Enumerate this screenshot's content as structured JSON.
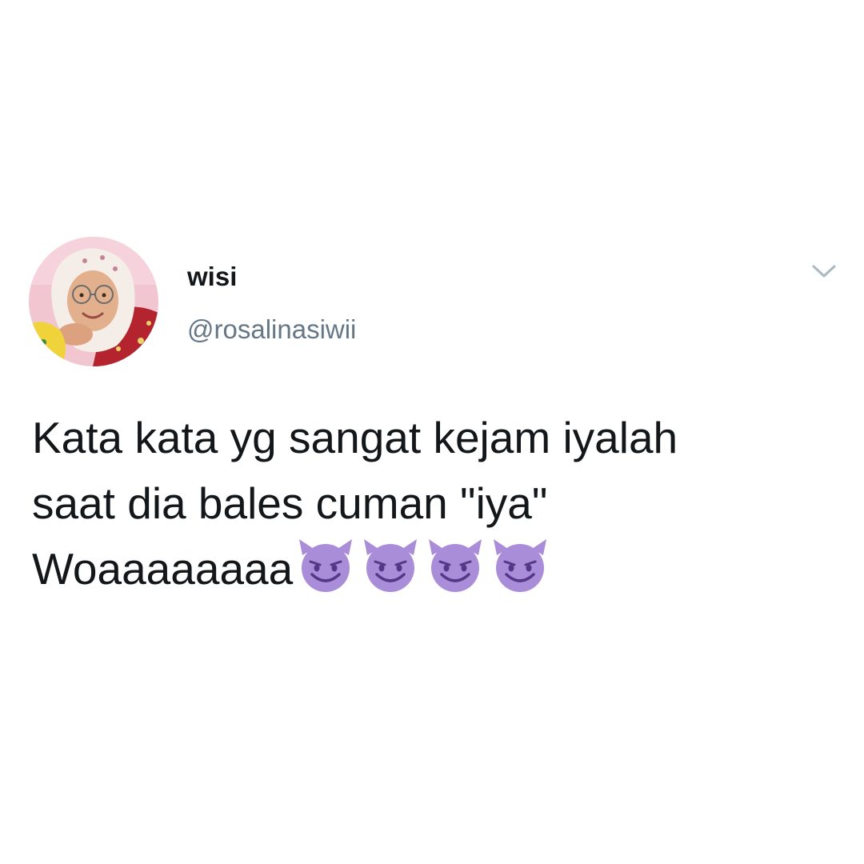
{
  "tweet": {
    "author": {
      "display_name": "wisi",
      "handle": "@rosalinasiwii"
    },
    "text_lines": [
      "Kata kata yg sangat kejam iyalah",
      "saat dia bales cuman \"iya\"",
      "Woaaaaaaaa"
    ],
    "emoji": [
      "smiling-imp-emoji",
      "smiling-imp-emoji",
      "smiling-imp-emoji",
      "smiling-imp-emoji"
    ],
    "menu_icon": "chevron-down-icon"
  },
  "colors": {
    "text": "#14171a",
    "handle": "#657786",
    "caret": "#aab8c2",
    "emoji": "#aa8dd8",
    "background": "#ffffff"
  }
}
